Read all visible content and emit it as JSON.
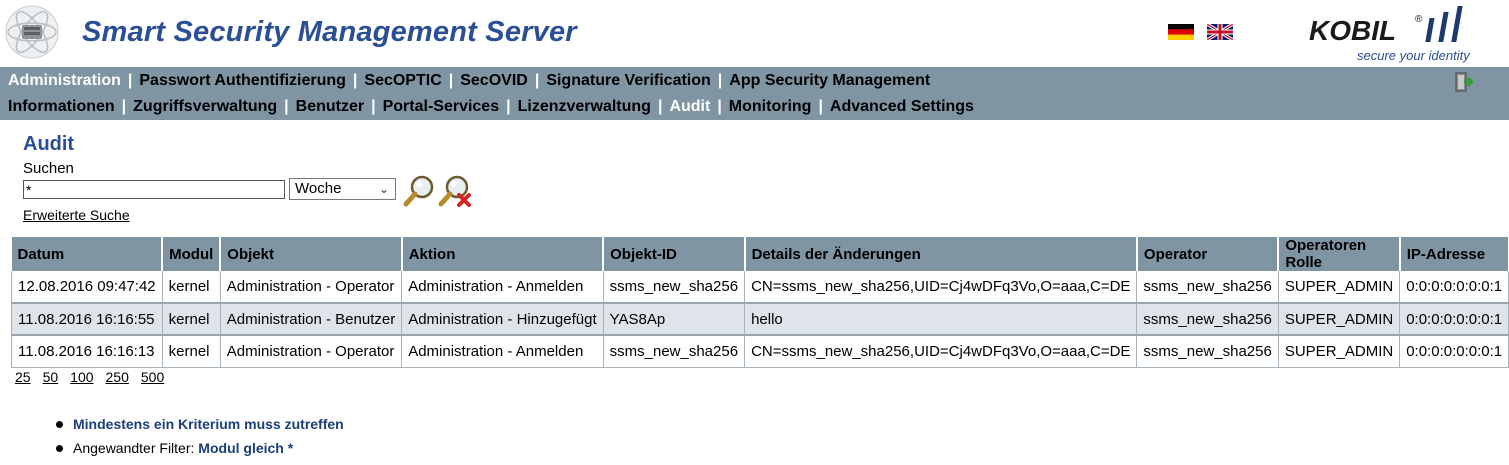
{
  "header": {
    "title": "Smart Security Management Server",
    "brand": {
      "name": "KOBIL",
      "slogan": "secure your identity"
    },
    "languages": [
      "de",
      "en"
    ]
  },
  "nav": {
    "row1": [
      "Administration",
      "Passwort Authentifizierung",
      "SecOPTIC",
      "SecOVID",
      "Signature Verification",
      "App Security Management"
    ],
    "row1_active": "Administration",
    "row2": [
      "Informationen",
      "Zugriffsverwaltung",
      "Benutzer",
      "Portal-Services",
      "Lizenzverwaltung",
      "Audit",
      "Monitoring",
      "Advanced Settings"
    ],
    "row2_active": "Audit"
  },
  "page": {
    "title": "Audit",
    "search_label": "Suchen",
    "search_value": "*",
    "period": "Woche",
    "advanced_link": "Erweiterte Suche"
  },
  "table": {
    "columns": [
      "Datum",
      "Modul",
      "Objekt",
      "Aktion",
      "Objekt-ID",
      "Details der Änderungen",
      "Operator",
      "Operatoren Rolle",
      "IP-Adresse"
    ],
    "rows": [
      [
        "12.08.2016 09:47:42",
        "kernel",
        "Administration - Operator",
        "Administration - Anmelden",
        "ssms_new_sha256",
        "CN=ssms_new_sha256,UID=Cj4wDFq3Vo,O=aaa,C=DE",
        "ssms_new_sha256",
        "SUPER_ADMIN",
        "0:0:0:0:0:0:0:1"
      ],
      [
        "11.08.2016 16:16:55",
        "kernel",
        "Administration - Benutzer",
        "Administration - Hinzugefügt",
        "YAS8Ap",
        "hello",
        "ssms_new_sha256",
        "SUPER_ADMIN",
        "0:0:0:0:0:0:0:1"
      ],
      [
        "11.08.2016 16:16:13",
        "kernel",
        "Administration - Operator",
        "Administration - Anmelden",
        "ssms_new_sha256",
        "CN=ssms_new_sha256,UID=Cj4wDFq3Vo,O=aaa,C=DE",
        "ssms_new_sha256",
        "SUPER_ADMIN",
        "0:0:0:0:0:0:0:1"
      ]
    ]
  },
  "pager": [
    "25",
    "50",
    "100",
    "250",
    "500"
  ],
  "filters": {
    "criteria": "Mindestens ein Kriterium muss zutreffen",
    "applied_label": "Angewandter Filter:",
    "applied_value": "Modul gleich",
    "applied_star": "*"
  },
  "colors": {
    "nav_bg": "#7f95a4",
    "title_blue": "#2a4f94",
    "alt_row": "#dfe3ea"
  }
}
